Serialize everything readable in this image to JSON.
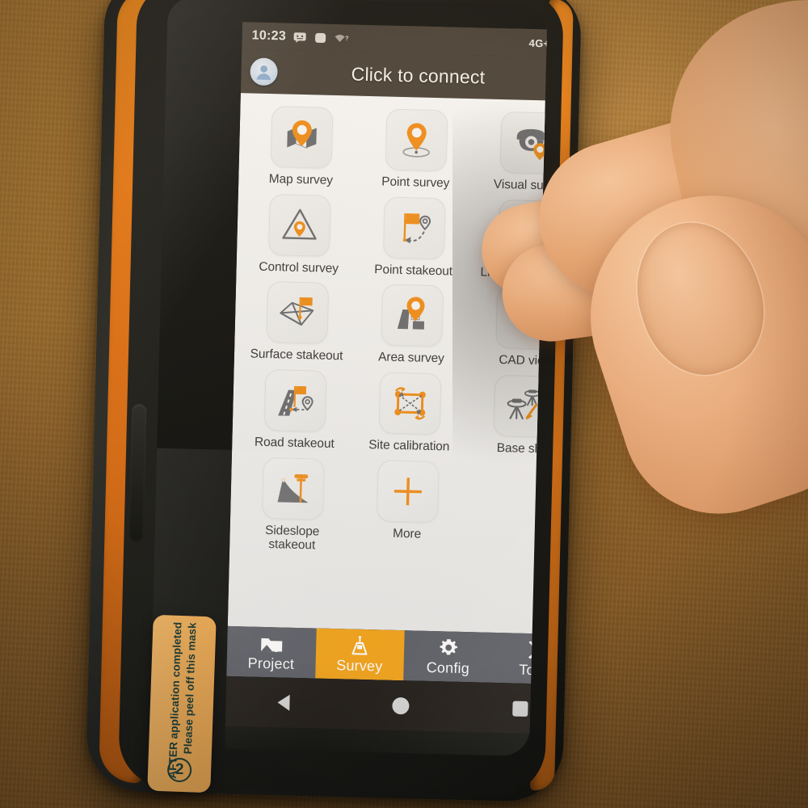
{
  "statusbar": {
    "time": "10:23",
    "icons": [
      "message-icon",
      "app-icon",
      "wifi-question-icon"
    ],
    "network": "4G",
    "network_plus": "+",
    "network_sup": "4G",
    "signal": "signal-bars-icon",
    "battery": "battery-icon"
  },
  "titlebar": {
    "avatar": "user-avatar-icon",
    "title": "Click to connect"
  },
  "grid": {
    "items": [
      {
        "label": "Map survey",
        "icon": "map-pin-icon"
      },
      {
        "label": "Point survey",
        "icon": "point-pin-icon"
      },
      {
        "label": "Visual survey",
        "icon": "camera-pin-icon"
      },
      {
        "label": "Control survey",
        "icon": "triangle-pin-icon"
      },
      {
        "label": "Point stakeout",
        "icon": "flag-arrow-pin-icon"
      },
      {
        "label": "Line/Arc stakeout",
        "icon": "line-arc-flag-icon"
      },
      {
        "label": "Surface stakeout",
        "icon": "surface-flag-icon"
      },
      {
        "label": "Area survey",
        "icon": "area-pin-icon"
      },
      {
        "label": "CAD view",
        "icon": "cad-magnifier-icon"
      },
      {
        "label": "Road stakeout",
        "icon": "road-flag-icon"
      },
      {
        "label": "Site calibration",
        "icon": "calibration-rect-icon"
      },
      {
        "label": "Base shift",
        "icon": "base-tripod-icon"
      },
      {
        "label": "Sideslope\nstakeout",
        "icon": "sideslope-pole-icon"
      },
      {
        "label": "More",
        "icon": "plus-icon"
      }
    ]
  },
  "fab": {
    "name": "play-expand-button",
    "icon": "play-icon"
  },
  "tabbar": {
    "items": [
      {
        "label": "Project",
        "icon": "folder-icon",
        "active": false
      },
      {
        "label": "Survey",
        "icon": "survey-icon",
        "active": true
      },
      {
        "label": "Config",
        "icon": "gear-icon",
        "active": false
      },
      {
        "label": "Tools",
        "icon": "tools-icon",
        "active": false
      }
    ],
    "active_color": "#f5a61d",
    "bar_color": "#60636b"
  },
  "navbar": {
    "back": "back-triangle-icon",
    "home": "home-circle-icon",
    "recents": "recents-square-icon"
  },
  "sticker": {
    "line1": "Please peel off this mask",
    "line2": "AFTER application completed",
    "number": "2"
  },
  "colors": {
    "accent_orange": "#f0901e",
    "tab_active": "#f5a61d",
    "titlebar": "#4b443c",
    "icon_gray": "#6e7073"
  }
}
